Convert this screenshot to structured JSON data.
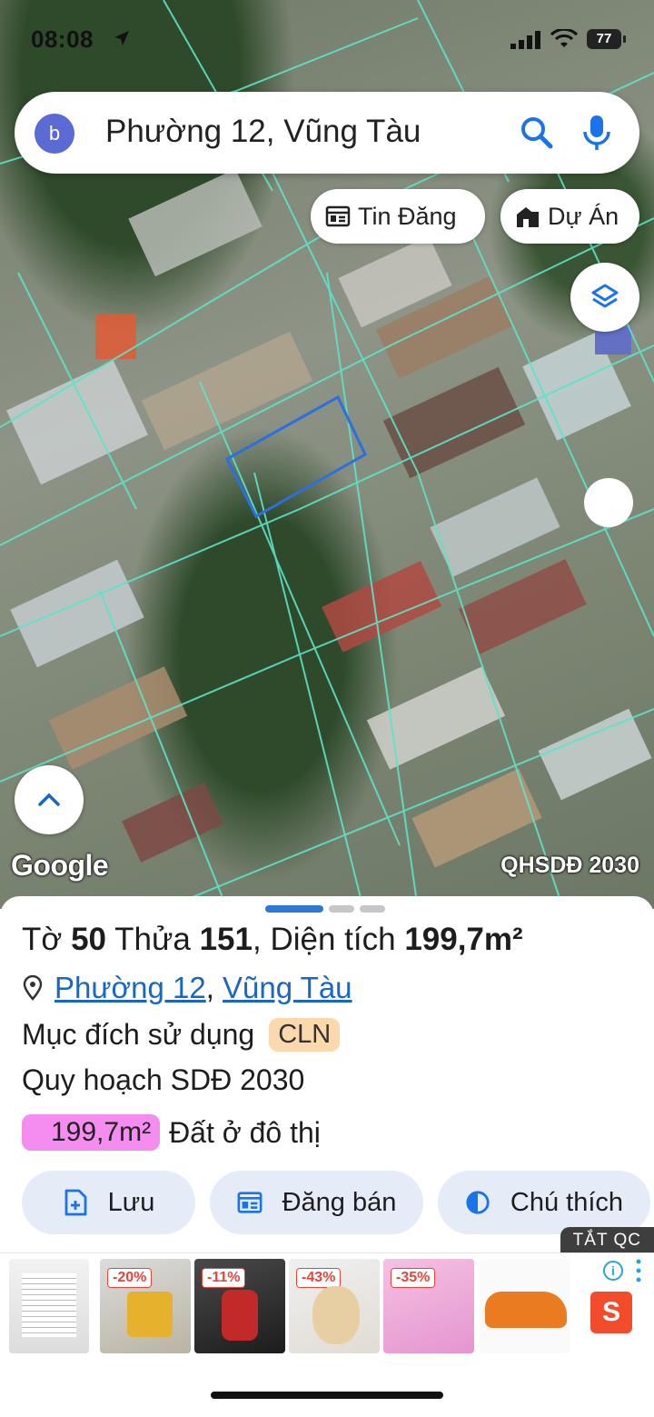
{
  "status_bar": {
    "time": "08:08",
    "battery": "77"
  },
  "search": {
    "avatar_letter": "b",
    "query": "Phường 12, Vũng Tàu"
  },
  "chips": {
    "tin_dang": "Tin Đăng",
    "du_an": "Dự Án"
  },
  "map": {
    "attribution": "Google",
    "overlay_label": "QHSDĐ 2030",
    "parcel_color": "#5ee3c9",
    "selected_color": "#2b6fe0"
  },
  "parcel": {
    "to_label": "Tờ",
    "to_value": "50",
    "thua_label": "Thửa",
    "thua_value": "151",
    "area_label": ", Diện tích",
    "area_value": "199,7m²",
    "ward": "Phường 12",
    "city": "Vũng Tàu",
    "purpose_label": "Mục đích sử dụng",
    "purpose_code": "CLN",
    "plan_label": "Quy hoạch SDĐ 2030",
    "plan_area": "199,7m²",
    "plan_type": "Đất ở đô thị"
  },
  "actions": {
    "save": "Lưu",
    "sell": "Đăng bán",
    "legend": "Chú thích"
  },
  "ads": {
    "close_label": "TẮT QC",
    "discounts": [
      "-20%",
      "-11%",
      "-43%",
      "-35%"
    ],
    "shop_letter": "S",
    "info": "i"
  }
}
